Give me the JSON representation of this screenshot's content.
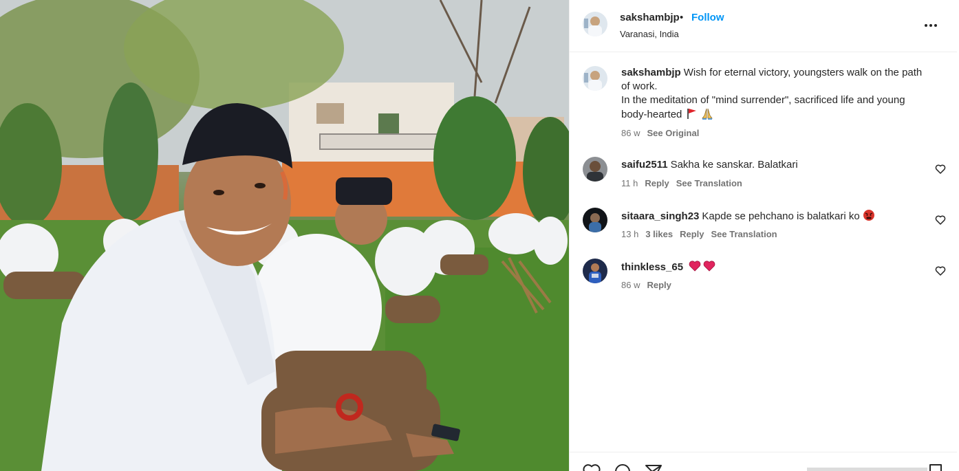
{
  "post": {
    "username": "sakshambjp",
    "separator": "•",
    "follow_label": "Follow",
    "location": "Varanasi, India"
  },
  "caption": {
    "username": "sakshambjp",
    "line1": "Wish for eternal victory, youngsters walk on the path of work.",
    "line2": "In the meditation of \"mind surrender\", sacrificed life and young body-hearted",
    "emoji": [
      "flag-icon",
      "folded-hands-icon"
    ],
    "age": "86 w",
    "see_original": "See Original"
  },
  "comments": [
    {
      "username": "saifu2511",
      "text": "Sakha ke sanskar. Balatkari",
      "age": "11 h",
      "likes": "",
      "reply": "Reply",
      "translate": "See Translation"
    },
    {
      "username": "sitaara_singh23",
      "text": "Kapde se pehchano is balatkari ko",
      "emoji": "angry-face-icon",
      "age": "13 h",
      "likes": "3 likes",
      "reply": "Reply",
      "translate": "See Translation"
    },
    {
      "username": "thinkless_65",
      "text": "",
      "emoji": "two-hearts-icon",
      "age": "86 w",
      "likes": "",
      "reply": "Reply",
      "translate": ""
    }
  ],
  "colors": {
    "accent": "#0095f6",
    "text": "#262626",
    "muted": "#737373",
    "heart_emoji": "#e0245e"
  }
}
